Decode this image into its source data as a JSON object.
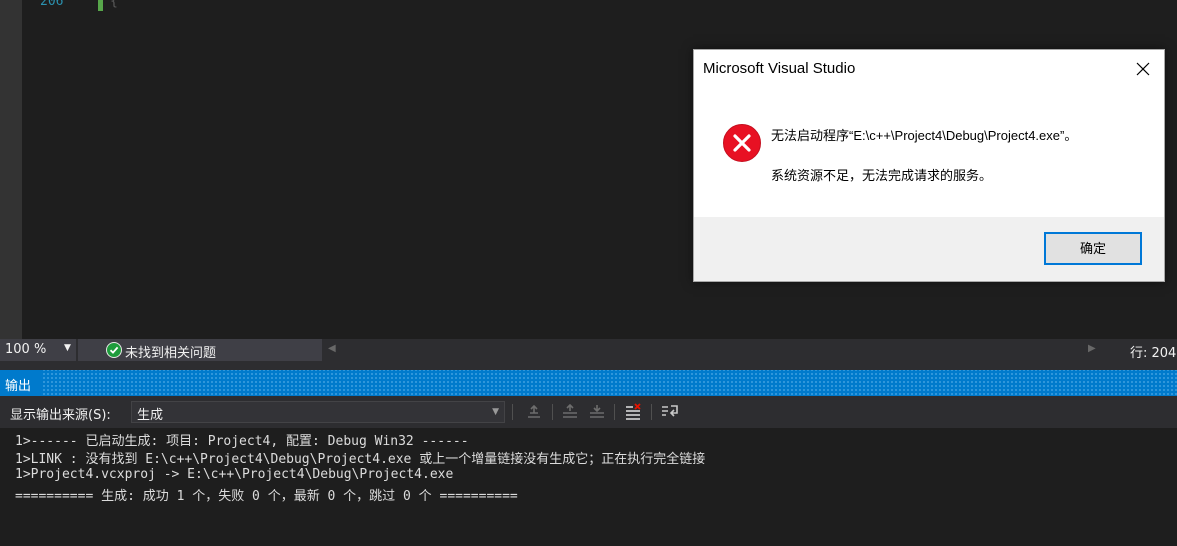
{
  "editor": {
    "line_number": "206",
    "code_text": "{"
  },
  "status_bar": {
    "zoom": "100 %",
    "issues": "未找到相关问题",
    "row": "行: 204"
  },
  "output_panel": {
    "title": "输出",
    "source_label": "显示输出来源(S):",
    "source_value": "生成",
    "lines": [
      "1>------ 已启动生成: 项目: Project4, 配置: Debug Win32 ------",
      "1>LINK : 没有找到 E:\\c++\\Project4\\Debug\\Project4.exe 或上一个增量链接没有生成它；正在执行完全链接",
      "1>Project4.vcxproj -> E:\\c++\\Project4\\Debug\\Project4.exe",
      "========== 生成: 成功 1 个，失败 0 个，最新 0 个，跳过 0 个 =========="
    ]
  },
  "dialog": {
    "title": "Microsoft Visual Studio",
    "message_line1": "无法启动程序“E:\\c++\\Project4\\Debug\\Project4.exe”。",
    "message_line2": "系统资源不足，无法完成请求的服务。",
    "ok_label": "确定"
  },
  "icons": {
    "status_ok": "check-circle-icon",
    "dialog_error": "error-x-icon",
    "dialog_close": "close-icon"
  },
  "colors": {
    "accent": "#007acc",
    "error": "#e81123",
    "ok_green": "#1e9c3c",
    "button_focus": "#0078d7"
  }
}
